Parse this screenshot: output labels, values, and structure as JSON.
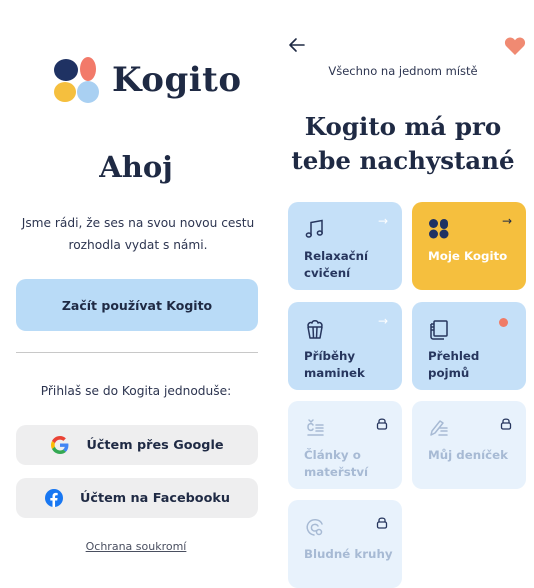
{
  "left": {
    "app_name": "Kogito",
    "greeting": "Ahoj",
    "intro": "Jsme rádi, že ses na svou novou cestu rozhodla vydat s námi.",
    "start_button": "Začít používat Kogito",
    "login_hint": "Přihlaš se do Kogita jednoduše:",
    "google_button": "Účtem přes Google",
    "facebook_button": "Účtem na Facebooku",
    "privacy_link": "Ochrana soukromí"
  },
  "right": {
    "subtitle": "Všechno na jednom místě",
    "title": "Kogito má pro tebe nachystané",
    "cards": [
      {
        "label": "Relaxační cvičení",
        "icon": "music-note-icon",
        "state": "open",
        "arrow": "→"
      },
      {
        "label": "Moje Kogito",
        "icon": "kogito-logo-icon",
        "state": "highlighted",
        "arrow": "→"
      },
      {
        "label": "Příběhy maminek",
        "icon": "popcorn-icon",
        "state": "open",
        "arrow": "→"
      },
      {
        "label": "Přehled pojmů",
        "icon": "glossary-icon",
        "state": "new",
        "badge_color": "#f07b66"
      },
      {
        "label": "Články o mateřství",
        "icon": "articles-icon",
        "state": "locked"
      },
      {
        "label": "Můj deníček",
        "icon": "pencil-notes-icon",
        "state": "locked"
      },
      {
        "label": "Bludné kruhy",
        "icon": "circles-icon",
        "state": "locked"
      }
    ]
  },
  "colors": {
    "primary_button": "#b9dbf7",
    "card_open": "#c5e0f8",
    "card_locked": "#e8f2fc",
    "card_highlight": "#f5bf3e",
    "text_dark": "#1f2a44",
    "heart": "#f08a72"
  }
}
